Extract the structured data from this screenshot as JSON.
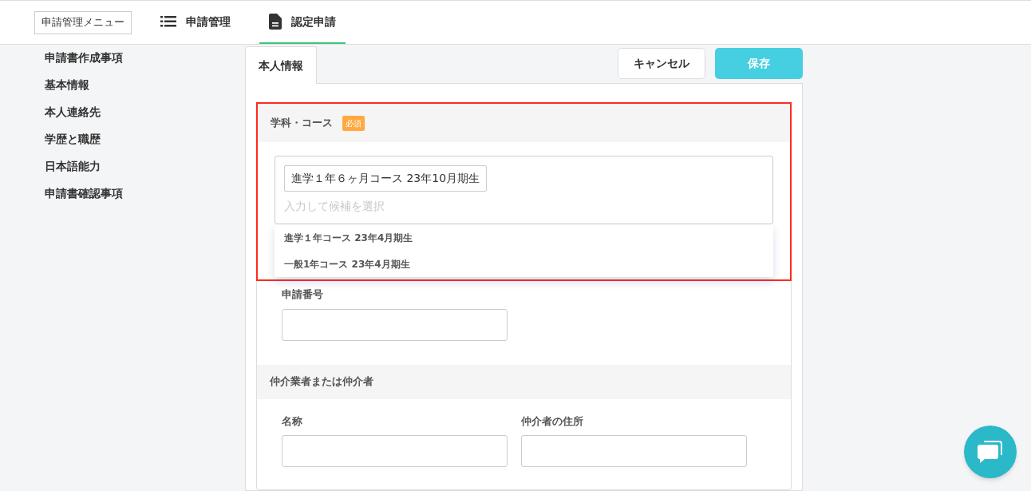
{
  "header": {
    "menu_button": "申請管理メニュー",
    "nav": [
      {
        "label": "申請管理",
        "kind": "list",
        "selected": false
      },
      {
        "label": "認定申請",
        "kind": "document",
        "selected": true
      }
    ]
  },
  "sidebar": {
    "items": [
      "申請書作成事項",
      "基本情報",
      "本人連絡先",
      "学歴と職歴",
      "日本語能力",
      "申請書確認事項"
    ]
  },
  "tabs": [
    {
      "label": "本人情報",
      "selected": true
    }
  ],
  "actions": {
    "cancel": "キャンセル",
    "save": "保存"
  },
  "course_section": {
    "title": "学科・コース",
    "badge": "必須",
    "highlighted": true,
    "selected_tags": [
      "進学１年６ヶ月コース 23年10月期生"
    ],
    "placeholder": "入力して候補を選択",
    "suggestions": [
      "進学１年コース 23年4月期生",
      "一般1年コース 23年4月期生"
    ]
  },
  "sections": [
    {
      "fields": [
        {
          "label": "申請番号"
        }
      ]
    },
    {
      "title": "仲介業者または仲介者",
      "fields": [
        {
          "label": "名称"
        },
        {
          "label": "仲介者の住所"
        }
      ]
    }
  ]
}
